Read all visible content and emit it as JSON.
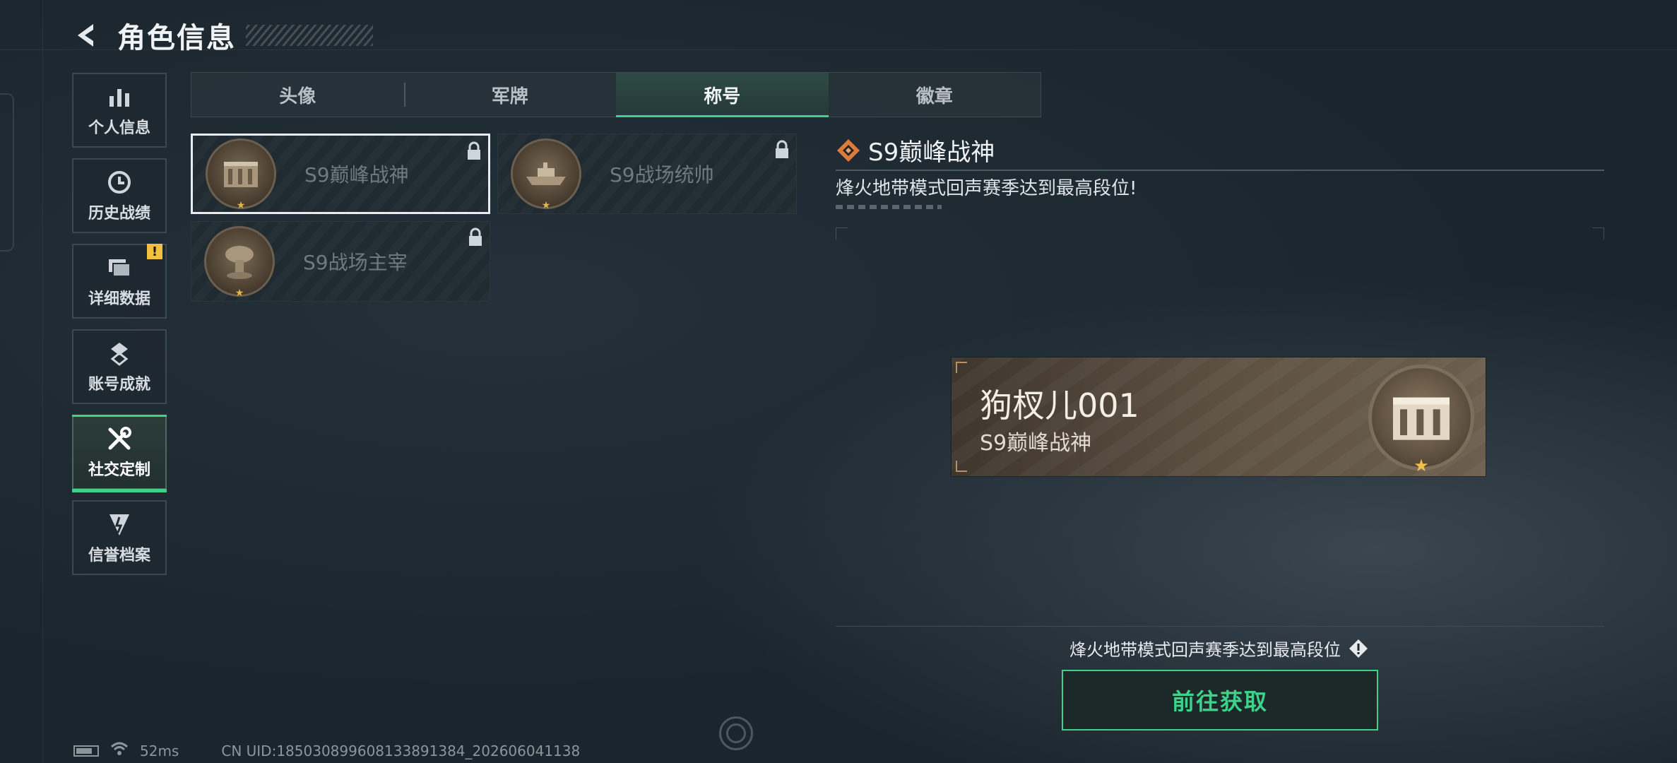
{
  "header": {
    "title": "角色信息"
  },
  "sidebar": {
    "items": [
      {
        "label": "个人信息",
        "icon": "bar-chart-icon",
        "active": false
      },
      {
        "label": "历史战绩",
        "icon": "history-icon",
        "active": false
      },
      {
        "label": "详细数据",
        "icon": "folder-icon",
        "active": false,
        "badge": "!"
      },
      {
        "label": "账号成就",
        "icon": "achievement-icon",
        "active": false
      },
      {
        "label": "社交定制",
        "icon": "tools-icon",
        "active": true
      },
      {
        "label": "信誉档案",
        "icon": "reputation-icon",
        "active": false
      }
    ]
  },
  "tabs": [
    {
      "label": "头像",
      "active": false
    },
    {
      "label": "军牌",
      "active": false
    },
    {
      "label": "称号",
      "active": true
    },
    {
      "label": "徽章",
      "active": false
    }
  ],
  "titles": [
    {
      "name": "S9巅峰战神",
      "locked": true,
      "selected": true,
      "medal": "fortress-medal-icon"
    },
    {
      "name": "S9战场统帅",
      "locked": true,
      "selected": false,
      "medal": "warship-medal-icon"
    },
    {
      "name": "S9战场主宰",
      "locked": true,
      "selected": false,
      "medal": "mushroom-cloud-medal-icon"
    }
  ],
  "detail": {
    "title": "S9巅峰战神",
    "description": "烽火地带模式回声赛季达到最高段位!"
  },
  "preview": {
    "player_name": "狗杈儿001",
    "title": "S9巅峰战神"
  },
  "requirement": {
    "text": "烽火地带模式回声赛季达到最高段位"
  },
  "action": {
    "label": "前往获取"
  },
  "status_bar": {
    "ping": "52ms",
    "uid": "CN UID:185030899608133891384_202606041138"
  },
  "colors": {
    "accent": "#3fd18a",
    "badge": "#f0c040",
    "title_icon": "#e07a3a"
  }
}
